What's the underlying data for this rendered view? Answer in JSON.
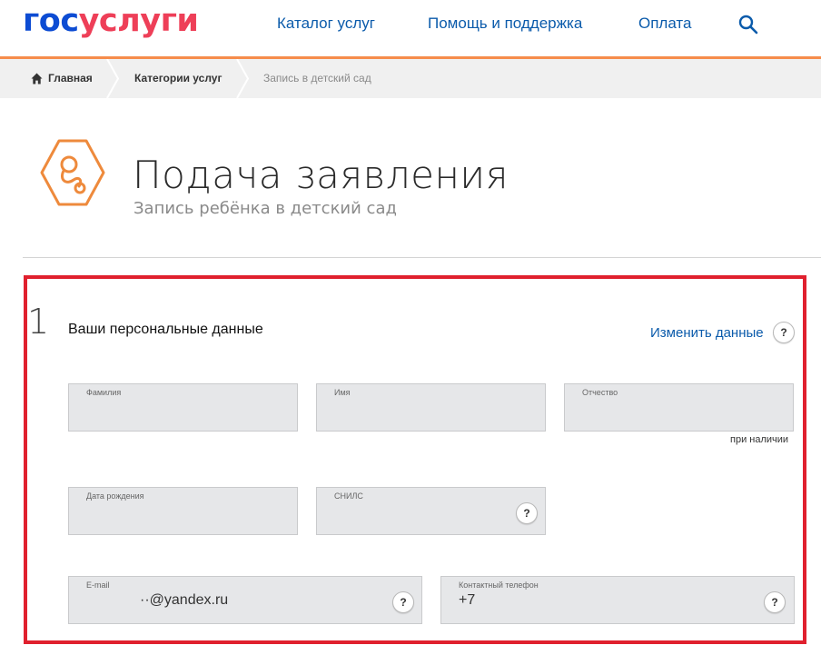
{
  "header": {
    "logo_gos": "гос",
    "logo_uslugi": "услуги",
    "nav": [
      "Каталог услуг",
      "Помощь и поддержка",
      "Оплата"
    ],
    "search_icon": "search-icon",
    "accent_color": "#f68c4b"
  },
  "breadcrumb": {
    "home": "Главная",
    "categories": "Категории услуг",
    "current": "Запись в детский сад"
  },
  "page": {
    "title": "Подача заявления",
    "subtitle": "Запись ребёнка в детский сад",
    "service_icon": "pacifier-icon"
  },
  "form": {
    "step": "1",
    "section_title": "Ваши персональные данные",
    "change_link": "Изменить данные",
    "help_label": "?",
    "fields": {
      "last_name": {
        "label": "Фамилия",
        "value": ""
      },
      "first_name": {
        "label": "Имя",
        "value": ""
      },
      "middle_name": {
        "label": "Отчество",
        "value": ""
      },
      "middle_name_hint": "при наличии",
      "birth_date": {
        "label": "Дата рождения",
        "value": ""
      },
      "snils": {
        "label": "СНИЛС",
        "value": ""
      },
      "email": {
        "label": "E-mail",
        "value": "··@yandex.ru"
      },
      "phone": {
        "label": "Контактный телефон",
        "value": "+7"
      }
    },
    "highlight_color": "#e0202e"
  }
}
